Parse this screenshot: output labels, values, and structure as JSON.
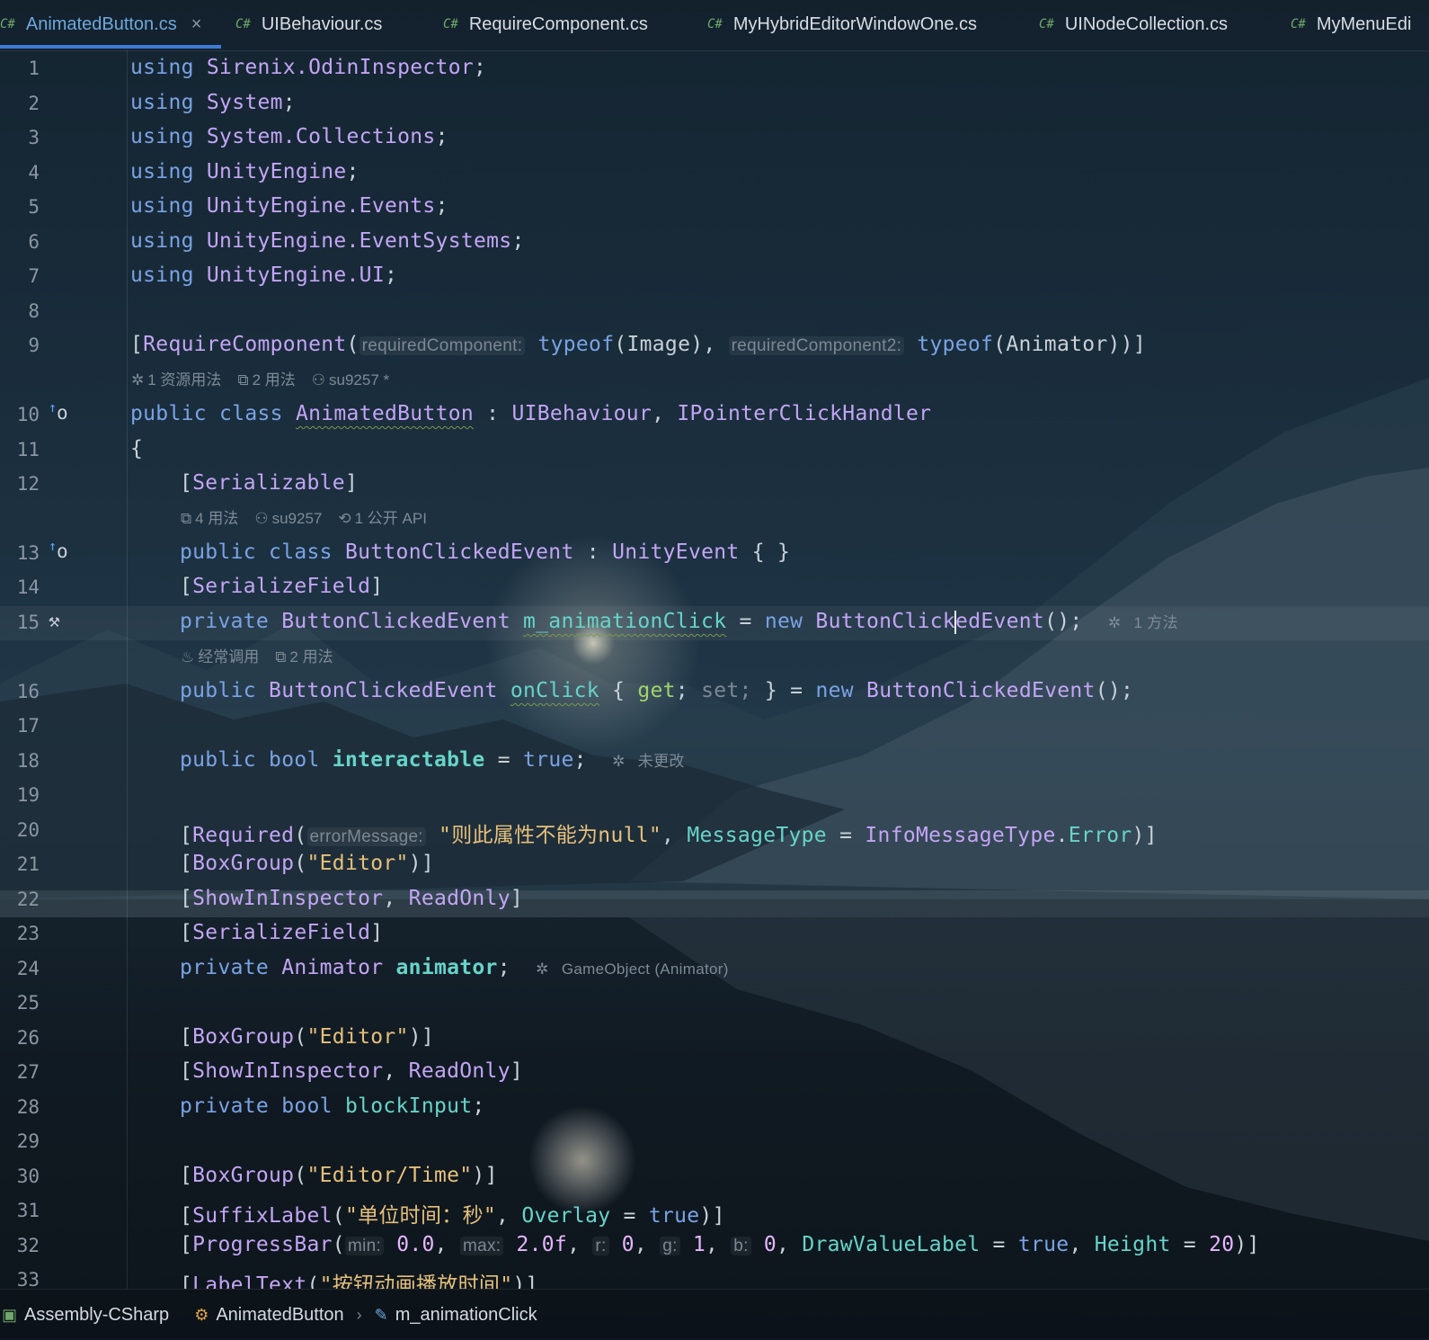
{
  "tabs": [
    {
      "prefix": "C#",
      "label": "AnimatedButton.cs",
      "active": true,
      "close": "×"
    },
    {
      "prefix": "C#",
      "label": "UIBehaviour.cs"
    },
    {
      "prefix": "C#",
      "label": "RequireComponent.cs"
    },
    {
      "prefix": "C#",
      "label": "MyHybridEditorWindowOne.cs"
    },
    {
      "prefix": "C#",
      "label": "UINodeCollection.cs"
    },
    {
      "prefix": "C#",
      "label": "MyMenuEdi"
    }
  ],
  "line_numbers": [
    "1",
    "2",
    "3",
    "4",
    "5",
    "6",
    "7",
    "8",
    "9",
    "10",
    "11",
    "12",
    "13",
    "14",
    "15",
    "16",
    "17",
    "18",
    "19",
    "20",
    "21",
    "22",
    "23",
    "24",
    "25",
    "26",
    "27",
    "28",
    "29",
    "30",
    "31",
    "32",
    "33"
  ],
  "code": {
    "l1": {
      "kw": "using",
      "ns": "Sirenix.OdinInspector",
      "end": ";"
    },
    "l2": {
      "kw": "using",
      "ns": "System",
      "end": ";"
    },
    "l3": {
      "kw": "using",
      "ns": "System.Collections",
      "end": ";"
    },
    "l4": {
      "kw": "using",
      "ns": "UnityEngine",
      "end": ";"
    },
    "l5": {
      "kw": "using",
      "ns": "UnityEngine.Events",
      "end": ";"
    },
    "l6": {
      "kw": "using",
      "ns": "UnityEngine.EventSystems",
      "end": ";"
    },
    "l7": {
      "kw": "using",
      "ns": "UnityEngine.UI",
      "end": ";"
    },
    "l9": {
      "open": "[",
      "attr": "RequireComponent",
      "paren": "(",
      "hint1": "requiredComponent:",
      "typeof1": "typeof",
      "arg1": "(Image), ",
      "hint2": "requiredComponent2:",
      "typeof2": "typeof",
      "arg2": "(Animator))]"
    },
    "l9_lens": {
      "a": "1 资源用法",
      "b": "2 用法",
      "c": "su9257 *"
    },
    "l10": {
      "kw1": "public",
      "kw2": "class",
      "name": "AnimatedButton",
      "colon": " : ",
      "base1": "UIBehaviour",
      "comma": ", ",
      "base2": "IPointerClickHandler"
    },
    "l11": {
      "text": "{"
    },
    "l12": {
      "open": "[",
      "attr": "Serializable",
      "close": "]"
    },
    "l12_lens": {
      "a": "4 用法",
      "b": "su9257",
      "c": "1 公开 API"
    },
    "l13": {
      "kw1": "public",
      "kw2": "class",
      "name": "ButtonClickedEvent",
      "colon": " : ",
      "base": "UnityEvent",
      "rest": " { }"
    },
    "l14": {
      "open": "[",
      "attr": "SerializeField",
      "close": "]"
    },
    "l15": {
      "kw1": "private",
      "type": "ButtonClickedEvent",
      "field": "m_animationClick",
      "eq": " = ",
      "kw2": "new",
      "ctor_a": "ButtonClick",
      "ctor_b": "edEvent",
      "rest": "();",
      "inlay": "1 方法"
    },
    "l15_lens": {
      "a": "经常调用",
      "b": "2 用法"
    },
    "l16": {
      "kw1": "public",
      "type": "ButtonClickedEvent",
      "field": "onClick",
      "brace": " { ",
      "get": "get",
      "semi": "; ",
      "set": "set;",
      "brace2": " } = ",
      "kw2": "new",
      "ctor": "ButtonClickedEvent",
      "rest": "();"
    },
    "l18": {
      "kw1": "public",
      "kw2": "bool",
      "field": "interactable",
      "eq": " = ",
      "val": "true",
      "rest": ";",
      "inlay": "未更改"
    },
    "l20": {
      "open": "[",
      "attr": "Required",
      "paren": "(",
      "hint": "errorMessage:",
      "str": "\"则此属性不能为null\"",
      "comma": ", ",
      "prop": "MessageType",
      "eq": " = ",
      "ty": "InfoMessageType",
      "dot": ".",
      "member": "Error",
      "close": ")]"
    },
    "l21": {
      "open": "[",
      "attr": "BoxGroup",
      "paren": "(",
      "str": "\"Editor\"",
      "close": ")]"
    },
    "l22": {
      "open": "[",
      "attr1": "ShowInInspector",
      "comma": ", ",
      "attr2": "ReadOnly",
      "close": "]"
    },
    "l23": {
      "open": "[",
      "attr": "SerializeField",
      "close": "]"
    },
    "l24": {
      "kw": "private",
      "type": "Animator",
      "field": "animator",
      "rest": ";",
      "inlay": "GameObject (Animator)"
    },
    "l26": {
      "open": "[",
      "attr": "BoxGroup",
      "paren": "(",
      "str": "\"Editor\"",
      "close": ")]"
    },
    "l27": {
      "open": "[",
      "attr1": "ShowInInspector",
      "comma": ", ",
      "attr2": "ReadOnly",
      "close": "]"
    },
    "l28": {
      "kw1": "private",
      "kw2": "bool",
      "field": "blockInput",
      "rest": ";"
    },
    "l30": {
      "open": "[",
      "attr": "BoxGroup",
      "paren": "(",
      "str": "\"Editor/Time\"",
      "close": ")]"
    },
    "l31": {
      "open": "[",
      "attr": "SuffixLabel",
      "paren": "(",
      "str": "\"单位时间：秒\"",
      "comma": ", ",
      "prop": "Overlay",
      "eq": " = ",
      "val": "true",
      "close": ")]"
    },
    "l32": {
      "open": "[",
      "attr": "ProgressBar",
      "paren": "(",
      "h1": "min:",
      "v1": "0.0",
      "c1": ", ",
      "h2": "max:",
      "v2": "2.0f",
      "c2": ", ",
      "h3": "r:",
      "v3": "0",
      "c3": ", ",
      "h4": "g:",
      "v4": "1",
      "c4": ", ",
      "h5": "b:",
      "v5": "0",
      "c5": ", ",
      "p1": "DrawValueLabel",
      "eq1": " = ",
      "t1": "true",
      "c6": ", ",
      "p2": "Height",
      "eq2": " = ",
      "v6": "20",
      "close": ")]"
    },
    "l33": {
      "open": "[",
      "attr": "LabelText",
      "paren": "(",
      "str": "\"按钮动画播放时间\"",
      "close": ")]"
    }
  },
  "statusbar": {
    "project": "Assembly-CSharp",
    "class": "AnimatedButton",
    "member": "m_animationClick",
    "sep": "›"
  },
  "colors": {
    "keyword": "#7aa3e5",
    "type": "#c3a5f5",
    "field": "#67d4c9",
    "string": "#e6c07b",
    "accent": "#3d7bd6"
  }
}
